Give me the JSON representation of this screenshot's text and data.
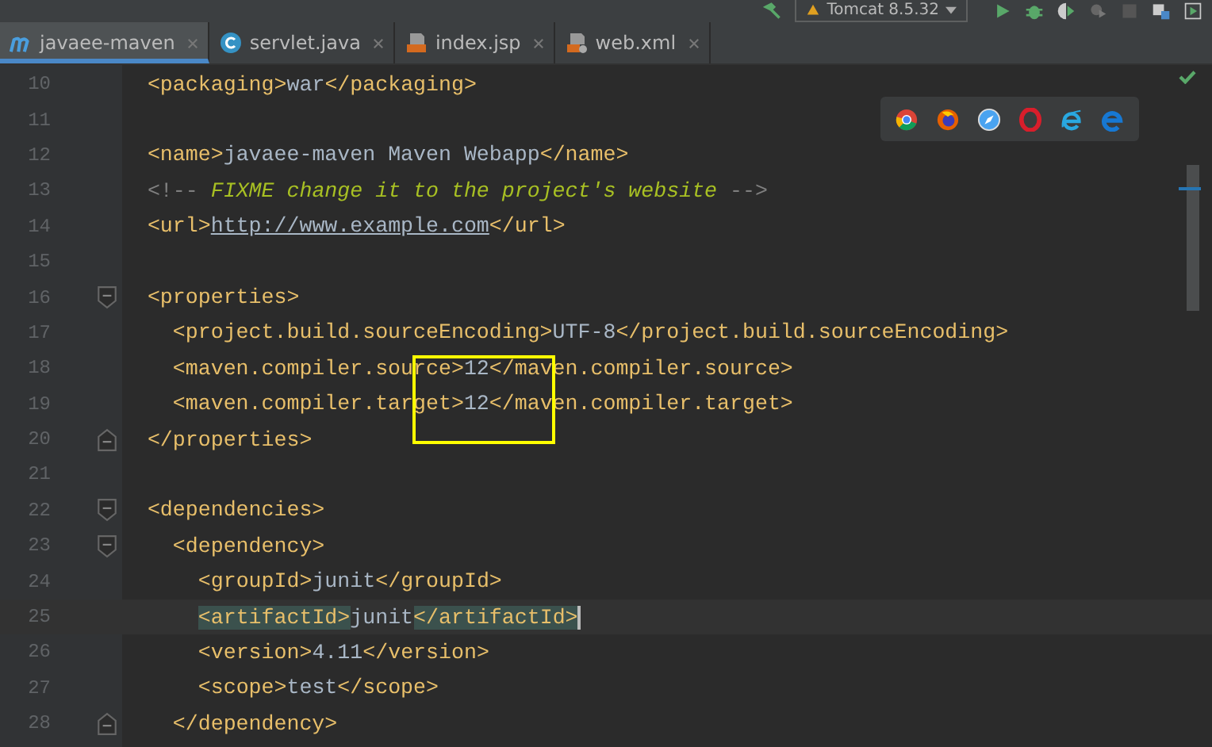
{
  "toolbar": {
    "run_configuration": "Tomcat 8.5.32"
  },
  "tabs": [
    {
      "label": "javaee-maven",
      "kind": "maven",
      "selected": true
    },
    {
      "label": "servlet.java",
      "kind": "class",
      "selected": false
    },
    {
      "label": "index.jsp",
      "kind": "jsp",
      "selected": false
    },
    {
      "label": "web.xml",
      "kind": "xml",
      "selected": false
    }
  ],
  "editor": {
    "lines": [
      {
        "number": "10",
        "tokens": [
          {
            "kind": "tag",
            "text": "<packaging>"
          },
          {
            "kind": "text",
            "text": "war"
          },
          {
            "kind": "tag",
            "text": "</packaging>"
          }
        ]
      },
      {
        "number": "11"
      },
      {
        "number": "12",
        "tokens": [
          {
            "kind": "tag",
            "text": "<name>"
          },
          {
            "kind": "text",
            "text": "javaee-maven Maven Webapp"
          },
          {
            "kind": "tag",
            "text": "</name>"
          }
        ]
      },
      {
        "number": "13",
        "tokens": [
          {
            "kind": "comment",
            "text": "<!-- "
          },
          {
            "kind": "todo",
            "text": "FIXME change it to the project's website"
          },
          {
            "kind": "comment",
            "text": " -->"
          }
        ]
      },
      {
        "number": "14",
        "tokens": [
          {
            "kind": "tag",
            "text": "<url>"
          },
          {
            "kind": "url",
            "text": "http://www.example.com"
          },
          {
            "kind": "tag",
            "text": "</url>"
          }
        ]
      },
      {
        "number": "15"
      },
      {
        "number": "16",
        "fold_start": true,
        "tokens": [
          {
            "kind": "tag",
            "text": "<properties>"
          }
        ],
        "children": [
          {
            "number": "17",
            "tokens": [
              {
                "kind": "tag",
                "text": "<project.build.sourceEncoding>"
              },
              {
                "kind": "text",
                "text": "UTF-8"
              },
              {
                "kind": "tag",
                "text": "</project.build.sourceEncoding>"
              }
            ]
          },
          {
            "number": "18",
            "tokens": [
              {
                "kind": "tag",
                "text": "<maven.compiler.source>"
              },
              {
                "kind": "text",
                "text": "12"
              },
              {
                "kind": "tag",
                "text": "</maven.compiler.source>"
              }
            ]
          },
          {
            "number": "19",
            "tokens": [
              {
                "kind": "tag",
                "text": "<maven.compiler.target>"
              },
              {
                "kind": "text",
                "text": "12"
              },
              {
                "kind": "tag",
                "text": "</maven.compiler.target>"
              }
            ]
          }
        ]
      },
      {
        "number": "20",
        "fold_end": true,
        "tokens": [
          {
            "kind": "tag",
            "text": "</properties>"
          }
        ]
      },
      {
        "number": "21"
      },
      {
        "number": "22",
        "fold_start": true,
        "tokens": [
          {
            "kind": "tag",
            "text": "<dependencies>"
          }
        ],
        "children": [
          {
            "number": "23",
            "fold_start": true,
            "tokens": [
              {
                "kind": "tag",
                "text": "<dependency>"
              }
            ],
            "children": [
              {
                "number": "24",
                "tokens": [
                  {
                    "kind": "tag",
                    "text": "<groupId>"
                  },
                  {
                    "kind": "text",
                    "text": "junit"
                  },
                  {
                    "kind": "tag",
                    "text": "</groupId>"
                  }
                ]
              },
              {
                "number": "25",
                "current": true,
                "tokens": [
                  {
                    "kind": "match",
                    "text": "<artifactId>"
                  },
                  {
                    "kind": "text",
                    "text": "junit"
                  },
                  {
                    "kind": "match",
                    "text": "</artifactId>"
                  }
                ]
              },
              {
                "number": "26",
                "tokens": [
                  {
                    "kind": "tag",
                    "text": "<version>"
                  },
                  {
                    "kind": "text",
                    "text": "4.11"
                  },
                  {
                    "kind": "tag",
                    "text": "</version>"
                  }
                ]
              },
              {
                "number": "27",
                "tokens": [
                  {
                    "kind": "tag",
                    "text": "<scope>"
                  },
                  {
                    "kind": "text",
                    "text": "test"
                  },
                  {
                    "kind": "tag",
                    "text": "</scope>"
                  }
                ]
              }
            ]
          },
          {
            "number": "28",
            "fold_end": true,
            "tokens": [
              {
                "kind": "tag",
                "text": "</dependency>"
              }
            ]
          }
        ]
      }
    ]
  }
}
